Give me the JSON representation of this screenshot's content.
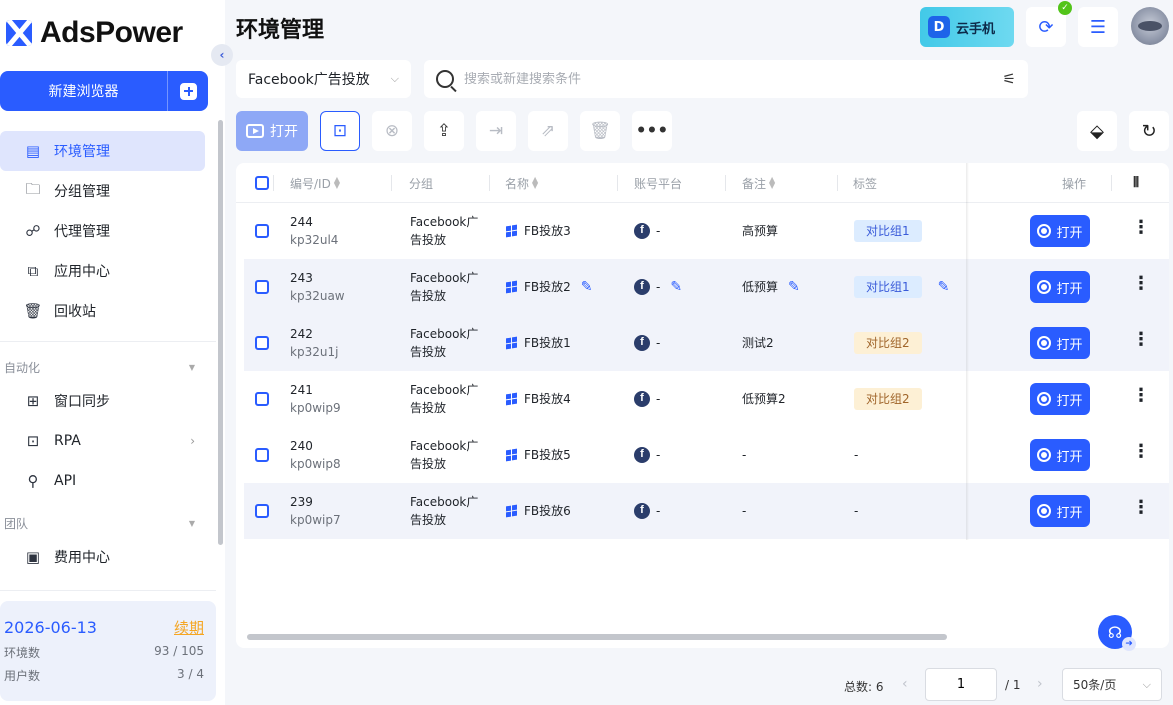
{
  "app": {
    "name": "AdsPower"
  },
  "sidebar": {
    "new_browser_label": "新建浏览器",
    "nav": [
      {
        "label": "环境管理",
        "icon": "folder-list-icon"
      },
      {
        "label": "分组管理",
        "icon": "folder-icon"
      },
      {
        "label": "代理管理",
        "icon": "proxy-icon"
      },
      {
        "label": "应用中心",
        "icon": "puzzle-icon"
      },
      {
        "label": "回收站",
        "icon": "trash-icon"
      }
    ],
    "automation_label": "自动化",
    "automation_items": [
      {
        "label": "窗口同步",
        "icon": "sync-window-icon"
      },
      {
        "label": "RPA",
        "icon": "robot-icon"
      },
      {
        "label": "API",
        "icon": "plug-icon"
      }
    ],
    "team_label": "团队",
    "team_items": [
      {
        "label": "费用中心",
        "icon": "wallet-icon"
      }
    ],
    "account": {
      "expiry": "2026-06-13",
      "renew": "续期",
      "env_label": "环境数",
      "env_value": "93 / 105",
      "user_label": "用户数",
      "user_value": "3 / 4"
    }
  },
  "header": {
    "title": "环境管理",
    "cloud_phone": "云手机"
  },
  "filters": {
    "group": "Facebook广告投放",
    "search_placeholder": "搜索或新建搜索条件"
  },
  "toolbar": {
    "open_label": "打开"
  },
  "table": {
    "columns": {
      "id": "编号/ID",
      "group": "分组",
      "name": "名称",
      "platform": "账号平台",
      "remark": "备注",
      "tags": "标签",
      "action": "操作"
    },
    "open_label": "打开",
    "rows": [
      {
        "no": "244",
        "id": "kp32ul4",
        "group": "Facebook广告投放",
        "name": "FB投放3",
        "platform": "-",
        "remark": "高预算",
        "tag": "对比组1",
        "tag_color": "blue",
        "editable": false
      },
      {
        "no": "243",
        "id": "kp32uaw",
        "group": "Facebook广告投放",
        "name": "FB投放2",
        "platform": "-",
        "remark": "低预算",
        "tag": "对比组1",
        "tag_color": "blue",
        "editable": true
      },
      {
        "no": "242",
        "id": "kp32u1j",
        "group": "Facebook广告投放",
        "name": "FB投放1",
        "platform": "-",
        "remark": "测试2",
        "tag": "对比组2",
        "tag_color": "orange",
        "editable": false
      },
      {
        "no": "241",
        "id": "kp0wip9",
        "group": "Facebook广告投放",
        "name": "FB投放4",
        "platform": "-",
        "remark": "低预算2",
        "tag": "对比组2",
        "tag_color": "orange",
        "editable": false
      },
      {
        "no": "240",
        "id": "kp0wip8",
        "group": "Facebook广告投放",
        "name": "FB投放5",
        "platform": "-",
        "remark": "-",
        "tag": "-",
        "tag_color": "none",
        "editable": false
      },
      {
        "no": "239",
        "id": "kp0wip7",
        "group": "Facebook广告投放",
        "name": "FB投放6",
        "platform": "-",
        "remark": "-",
        "tag": "-",
        "tag_color": "none",
        "editable": false
      }
    ]
  },
  "pagination": {
    "total": "总数: 6",
    "page": "1",
    "of": "/ 1",
    "page_size": "50条/页"
  }
}
